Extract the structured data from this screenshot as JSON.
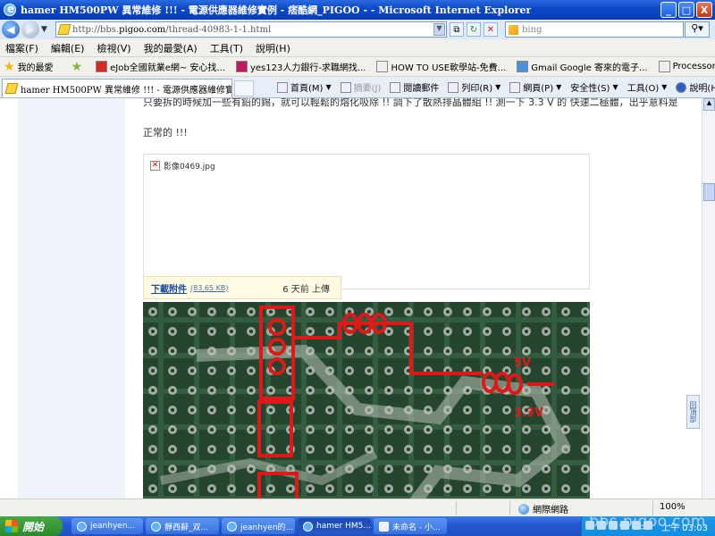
{
  "window": {
    "title": "hamer HM500PW 異常維修 !!! - 電源供應器維修實例 - 痞酷網_PIGOO - - Microsoft Internet Explorer",
    "buttons": {
      "minimize": "_",
      "maximize": "□",
      "close": "X"
    }
  },
  "address_bar": {
    "url_prefix": "http://bbs.",
    "url_domain": "pigoo.com",
    "url_path": "/thread-40983-1-1.html",
    "search_placeholder": "bing"
  },
  "menu": [
    "檔案(F)",
    "編輯(E)",
    "檢視(V)",
    "我的最愛(A)",
    "工具(T)",
    "說明(H)"
  ],
  "favorites_bar": {
    "label": "我的最愛",
    "items": [
      {
        "label": "eJob全國就業e網~ 安心找...",
        "icon": "ejob-icon",
        "color": "#d42a2a"
      },
      {
        "label": "yes123人力銀行-求職網找...",
        "icon": "yes123-icon",
        "color": "#c01a5e"
      },
      {
        "label": "HOW TO USE軟學站-免費...",
        "icon": "page-icon",
        "color": "#eeeeee"
      },
      {
        "label": "Gmail Google 寄來的電子...",
        "icon": "gmail-icon",
        "color": "#4a90d9"
      },
      {
        "label": "Processor Spec Finder",
        "icon": "page-icon",
        "color": "#eeeeee"
      }
    ]
  },
  "tab": {
    "label": "hamer HM500PW 異常維修 !!! - 電源供應器維修實..."
  },
  "command_bar": [
    {
      "label": "首頁(M)",
      "icon": "home-icon",
      "dim": false
    },
    {
      "label": "摘要(J)",
      "icon": "feed-icon",
      "dim": true
    },
    {
      "label": "閱讀郵件",
      "icon": "mail-icon",
      "dim": false
    },
    {
      "label": "列印(R)",
      "icon": "print-icon",
      "dim": false
    },
    {
      "label": "網頁(P)",
      "icon": "page-icon",
      "dim": false
    },
    {
      "label": "安全性(S)",
      "icon": "safety-icon",
      "dim": false
    },
    {
      "label": "工具(O)",
      "icon": "tools-icon",
      "dim": false
    },
    {
      "label": "說明(H)",
      "icon": "help-icon",
      "dim": false
    }
  ],
  "post": {
    "top_text": "只要拆的時候加一些有鉛的錫，就可以輕鬆的熔化吸除 !! 調下了散熱排晶體組 !! 測一下 3.3 V 的 快速二極體，出乎意料是",
    "line2": "正常的 !!!",
    "attachment": {
      "filename": "影像0469.jpg",
      "download_label": "下載附件",
      "size": "(83.65 KB)",
      "uploaded": "6 天前 上傳"
    },
    "photo_labels": [
      "5V",
      "3.3V"
    ]
  },
  "back_to_top": "回頂部",
  "status_bar": {
    "network": "網際網路",
    "zoom": "100%"
  },
  "taskbar": {
    "start": "開始",
    "tasks": [
      {
        "label": "jeanhyen...",
        "active": false
      },
      {
        "label": "靜西辭_双...",
        "active": false
      },
      {
        "label": "jeanhyen的...",
        "active": false
      },
      {
        "label": "hamer HM5...",
        "active": true
      },
      {
        "label": "未命名 - 小...",
        "active": false
      }
    ],
    "clock": "上午 03:03",
    "watermark": "bbs.pigoo.com"
  },
  "colors": {
    "title_blue": "#0b47c6",
    "trace_red": "#e01818",
    "link_blue": "#1a4aa0"
  }
}
